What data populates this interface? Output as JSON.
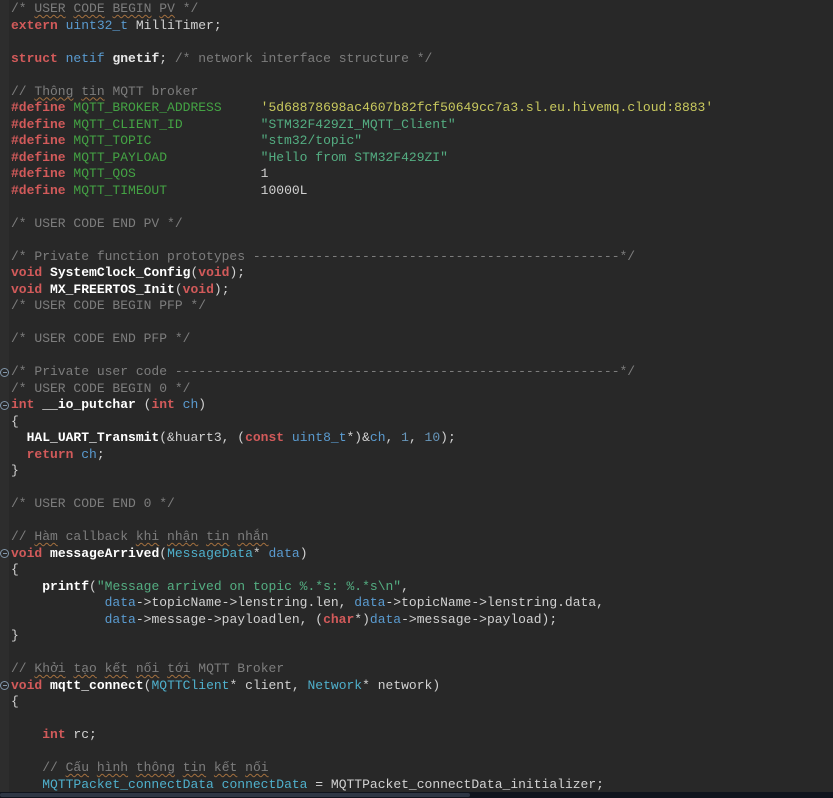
{
  "app": {
    "name": "code-editor"
  },
  "scrollbar": {
    "orientation": "horizontal"
  },
  "editor": {
    "language": "c",
    "colors": {
      "bg": "#282828",
      "gutter": "#2d2d2d",
      "comment": "#7d7d7d",
      "keyword": "#d25a5a",
      "macro": "#44a344",
      "string": "#54ae82",
      "charlit": "#c9c95e",
      "type": "#5a9bd0",
      "type2": "#4fb0cc",
      "variable": "#5a9bd0",
      "number": "#6897bb",
      "function": "#ffffff",
      "plain": "#d2d2d2",
      "squiggle": "#a3703f",
      "fold": "#8195a8",
      "scroll_track": "#10141d",
      "scroll_thumb": "#2e3644"
    },
    "lines": [
      {
        "tokens": [
          [
            "c",
            "/* "
          ],
          [
            "c sq",
            "USER"
          ],
          [
            "c",
            " "
          ],
          [
            "c sq",
            "CODE"
          ],
          [
            "c",
            " "
          ],
          [
            "c sq",
            "BEGIN"
          ],
          [
            "c",
            " "
          ],
          [
            "c sq",
            "PV"
          ],
          [
            "c",
            " */"
          ]
        ]
      },
      {
        "tokens": [
          [
            "k",
            "extern"
          ],
          [
            "p",
            " "
          ],
          [
            "t",
            "uint32_t"
          ],
          [
            "p",
            " MilliTimer;"
          ]
        ]
      },
      {
        "tokens": []
      },
      {
        "tokens": [
          [
            "k",
            "struct"
          ],
          [
            "p",
            " "
          ],
          [
            "t",
            "netif"
          ],
          [
            "p",
            " "
          ],
          [
            "b",
            "gnetif"
          ],
          [
            "p",
            "; "
          ],
          [
            "c",
            "/* network interface structure */"
          ]
        ]
      },
      {
        "tokens": []
      },
      {
        "tokens": [
          [
            "c",
            "// "
          ],
          [
            "c sq",
            "Thông"
          ],
          [
            "c",
            " "
          ],
          [
            "c sq",
            "tin"
          ],
          [
            "c",
            " MQTT broker"
          ]
        ]
      },
      {
        "tokens": [
          [
            "k",
            "#define"
          ],
          [
            "p",
            " "
          ],
          [
            "m",
            "MQTT_BROKER_ADDRESS"
          ],
          [
            "p",
            "     "
          ],
          [
            "q",
            "'5d68878698ac4607b82fcf50649cc7a3.sl.eu.hivemq.cloud:8883'"
          ]
        ]
      },
      {
        "tokens": [
          [
            "k",
            "#define"
          ],
          [
            "p",
            " "
          ],
          [
            "m",
            "MQTT_CLIENT_ID"
          ],
          [
            "p",
            "          "
          ],
          [
            "s",
            "\"STM32F429ZI_MQTT_Client\""
          ]
        ]
      },
      {
        "tokens": [
          [
            "k",
            "#define"
          ],
          [
            "p",
            " "
          ],
          [
            "m",
            "MQTT_TOPIC"
          ],
          [
            "p",
            "              "
          ],
          [
            "s",
            "\"stm32/topic\""
          ]
        ]
      },
      {
        "tokens": [
          [
            "k",
            "#define"
          ],
          [
            "p",
            " "
          ],
          [
            "m",
            "MQTT_PAYLOAD"
          ],
          [
            "p",
            "            "
          ],
          [
            "s",
            "\"Hello from STM32F429ZI\""
          ]
        ]
      },
      {
        "tokens": [
          [
            "k",
            "#define"
          ],
          [
            "p",
            " "
          ],
          [
            "m",
            "MQTT_QOS"
          ],
          [
            "p",
            "                1"
          ]
        ]
      },
      {
        "tokens": [
          [
            "k",
            "#define"
          ],
          [
            "p",
            " "
          ],
          [
            "m",
            "MQTT_TIMEOUT"
          ],
          [
            "p",
            "            10000L"
          ]
        ]
      },
      {
        "tokens": []
      },
      {
        "tokens": [
          [
            "c",
            "/* USER CODE END PV */"
          ]
        ]
      },
      {
        "tokens": []
      },
      {
        "tokens": [
          [
            "c",
            "/* Private function prototypes -----------------------------------------------*/"
          ]
        ]
      },
      {
        "tokens": [
          [
            "k",
            "void"
          ],
          [
            "p",
            " "
          ],
          [
            "f",
            "SystemClock_Config"
          ],
          [
            "p",
            "("
          ],
          [
            "k",
            "void"
          ],
          [
            "p",
            ");"
          ]
        ]
      },
      {
        "tokens": [
          [
            "k",
            "void"
          ],
          [
            "p",
            " "
          ],
          [
            "f",
            "MX_FREERTOS_Init"
          ],
          [
            "p",
            "("
          ],
          [
            "k",
            "void"
          ],
          [
            "p",
            ");"
          ]
        ]
      },
      {
        "tokens": [
          [
            "c",
            "/* USER CODE BEGIN PFP */"
          ]
        ]
      },
      {
        "tokens": []
      },
      {
        "tokens": [
          [
            "c",
            "/* USER CODE END PFP */"
          ]
        ]
      },
      {
        "tokens": []
      },
      {
        "fold": true,
        "tokens": [
          [
            "c",
            "/* Private user code ---------------------------------------------------------*/"
          ]
        ]
      },
      {
        "tokens": [
          [
            "c",
            "/* USER CODE BEGIN 0 */"
          ]
        ]
      },
      {
        "fold": true,
        "tokens": [
          [
            "k",
            "int"
          ],
          [
            "p",
            " "
          ],
          [
            "f",
            "__io_putchar"
          ],
          [
            "p",
            " ("
          ],
          [
            "k",
            "int"
          ],
          [
            "p",
            " "
          ],
          [
            "v",
            "ch"
          ],
          [
            "p",
            ")"
          ]
        ]
      },
      {
        "tokens": [
          [
            "p",
            "{"
          ]
        ]
      },
      {
        "tokens": [
          [
            "p",
            "  "
          ],
          [
            "f",
            "HAL_UART_Transmit"
          ],
          [
            "p",
            "(&huart3, ("
          ],
          [
            "k",
            "const"
          ],
          [
            "p",
            " "
          ],
          [
            "t",
            "uint8_t"
          ],
          [
            "p",
            "*)&"
          ],
          [
            "v",
            "ch"
          ],
          [
            "p",
            ", "
          ],
          [
            "n",
            "1"
          ],
          [
            "p",
            ", "
          ],
          [
            "n",
            "10"
          ],
          [
            "p",
            ");"
          ]
        ]
      },
      {
        "tokens": [
          [
            "p",
            "  "
          ],
          [
            "k",
            "return"
          ],
          [
            "p",
            " "
          ],
          [
            "v",
            "ch"
          ],
          [
            "p",
            ";"
          ]
        ]
      },
      {
        "tokens": [
          [
            "p",
            "}"
          ]
        ]
      },
      {
        "tokens": []
      },
      {
        "tokens": [
          [
            "c",
            "/* USER CODE END 0 */"
          ]
        ]
      },
      {
        "tokens": []
      },
      {
        "tokens": [
          [
            "c",
            "// "
          ],
          [
            "c sq",
            "Hàm"
          ],
          [
            "c",
            " callback "
          ],
          [
            "c sq",
            "khi"
          ],
          [
            "c",
            " "
          ],
          [
            "c sq",
            "nhận"
          ],
          [
            "c",
            " "
          ],
          [
            "c sq",
            "tin"
          ],
          [
            "c",
            " "
          ],
          [
            "c sq",
            "nhắn"
          ]
        ]
      },
      {
        "fold": true,
        "tokens": [
          [
            "k",
            "void"
          ],
          [
            "p",
            " "
          ],
          [
            "f",
            "messageArrived"
          ],
          [
            "p",
            "("
          ],
          [
            "t2",
            "MessageData"
          ],
          [
            "p",
            "* "
          ],
          [
            "v",
            "data"
          ],
          [
            "p",
            ")"
          ]
        ]
      },
      {
        "tokens": [
          [
            "p",
            "{"
          ]
        ]
      },
      {
        "tokens": [
          [
            "p",
            "    "
          ],
          [
            "f",
            "printf"
          ],
          [
            "p",
            "("
          ],
          [
            "s",
            "\"Message arrived on topic %.*s: %.*s\\n\""
          ],
          [
            "p",
            ","
          ]
        ]
      },
      {
        "tokens": [
          [
            "p",
            "            "
          ],
          [
            "v",
            "data"
          ],
          [
            "p",
            "->topicName->lenstring.len, "
          ],
          [
            "v",
            "data"
          ],
          [
            "p",
            "->topicName->lenstring.data,"
          ]
        ]
      },
      {
        "tokens": [
          [
            "p",
            "            "
          ],
          [
            "v",
            "data"
          ],
          [
            "p",
            "->message->payloadlen, ("
          ],
          [
            "k",
            "char"
          ],
          [
            "p",
            "*)"
          ],
          [
            "v",
            "data"
          ],
          [
            "p",
            "->message->payload);"
          ]
        ]
      },
      {
        "tokens": [
          [
            "p",
            "}"
          ]
        ]
      },
      {
        "tokens": []
      },
      {
        "tokens": [
          [
            "c",
            "// "
          ],
          [
            "c sq",
            "Khởi"
          ],
          [
            "c",
            " "
          ],
          [
            "c sq",
            "tạo"
          ],
          [
            "c",
            " "
          ],
          [
            "c sq",
            "kết"
          ],
          [
            "c",
            " "
          ],
          [
            "c sq",
            "nối"
          ],
          [
            "c",
            " "
          ],
          [
            "c sq",
            "tới"
          ],
          [
            "c",
            " MQTT Broker"
          ]
        ]
      },
      {
        "fold": true,
        "tokens": [
          [
            "k",
            "void"
          ],
          [
            "p",
            " "
          ],
          [
            "f",
            "mqtt_connect"
          ],
          [
            "p",
            "("
          ],
          [
            "t2",
            "MQTTClient"
          ],
          [
            "p",
            "* client, "
          ],
          [
            "t2",
            "Network"
          ],
          [
            "p",
            "* network)"
          ]
        ]
      },
      {
        "tokens": [
          [
            "p",
            "{"
          ]
        ]
      },
      {
        "tokens": []
      },
      {
        "tokens": [
          [
            "p",
            "    "
          ],
          [
            "k",
            "int"
          ],
          [
            "p",
            " rc;"
          ]
        ]
      },
      {
        "tokens": []
      },
      {
        "tokens": [
          [
            "p",
            "    "
          ],
          [
            "c",
            "// "
          ],
          [
            "c sq",
            "Cấu"
          ],
          [
            "c",
            " "
          ],
          [
            "c sq",
            "hình"
          ],
          [
            "c",
            " "
          ],
          [
            "c sq",
            "thông"
          ],
          [
            "c",
            " "
          ],
          [
            "c sq",
            "tin"
          ],
          [
            "c",
            " "
          ],
          [
            "c sq",
            "kết"
          ],
          [
            "c",
            " "
          ],
          [
            "c sq",
            "nối"
          ]
        ]
      },
      {
        "tokens": [
          [
            "p",
            "    "
          ],
          [
            "t2",
            "MQTTPacket_connectData"
          ],
          [
            "p",
            " "
          ],
          [
            "t2",
            "connectData"
          ],
          [
            "p",
            " = MQTTPacket_connectData_initializer;"
          ]
        ]
      }
    ]
  }
}
